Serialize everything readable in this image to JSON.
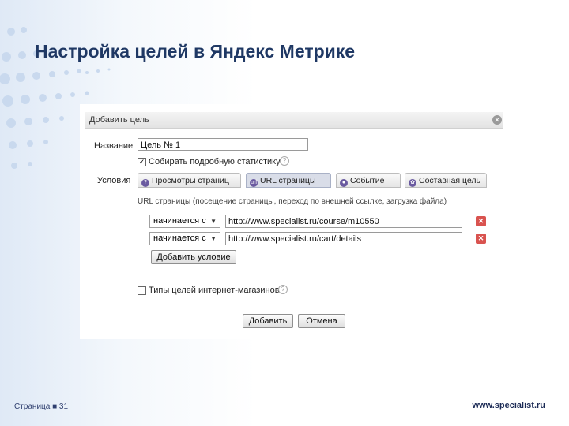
{
  "slide": {
    "title": "Настройка целей в Яндекс Метрике",
    "footer_page": "Страница ■ 31",
    "footer_site": "www.specialist.ru"
  },
  "dialog": {
    "title": "Добавить цель",
    "close_icon": "close-icon",
    "name_label": "Название",
    "name_value": "Цель № 1",
    "detailed_stats_label": "Собирать подробную статистику",
    "detailed_stats_checked": true,
    "conditions_label": "Условия",
    "tabs": [
      {
        "label": "Просмотры страниц",
        "icon": "pageviews-icon",
        "active": false
      },
      {
        "label": "URL страницы",
        "icon": "url-icon",
        "active": true
      },
      {
        "label": "Событие",
        "icon": "event-icon",
        "active": false
      },
      {
        "label": "Составная цель",
        "icon": "composite-goal-icon",
        "active": false
      }
    ],
    "url_hint": "URL страницы (посещение страницы, переход по внешней ссылке, загрузка файла)",
    "conditions": [
      {
        "operator": "начинается с",
        "value": "http://www.specialist.ru/course/m10550"
      },
      {
        "operator": "начинается с",
        "value": "http://www.specialist.ru/cart/details"
      }
    ],
    "add_condition_label": "Добавить условие",
    "ecommerce_label": "Типы целей интернет-магазинов",
    "ecommerce_checked": false,
    "submit_label": "Добавить",
    "cancel_label": "Отмена"
  },
  "colors": {
    "title": "#1f3864",
    "delete": "#d9534f",
    "accent_dots": "#c5d7ee"
  }
}
